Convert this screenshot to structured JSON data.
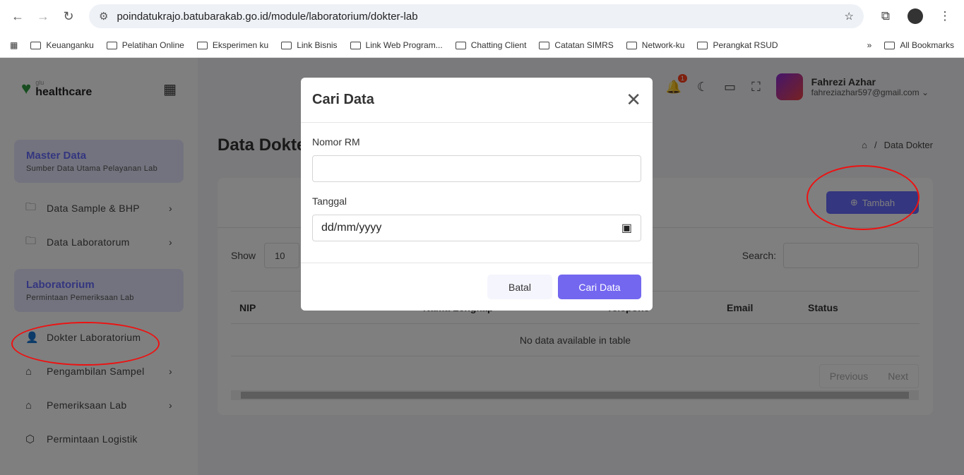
{
  "browser": {
    "url": "poindatukrajo.batubarakab.go.id/module/laboratorium/dokter-lab",
    "bookmarks": [
      "Keuanganku",
      "Pelatihan Online",
      "Eksperimen ku",
      "Link Bisnis",
      "Link Web Program...",
      "Chatting Client",
      "Catatan SIMRS",
      "Network-ku",
      "Perangkat RSUD"
    ],
    "all_bookmarks": "All Bookmarks"
  },
  "logo": {
    "small": "glu",
    "name": "healthcare"
  },
  "sidebar": {
    "master": {
      "title": "Master Data",
      "subtitle": "Sumber Data Utama Pelayanan Lab"
    },
    "master_items": [
      {
        "label": "Data Sample & BHP"
      },
      {
        "label": "Data Laboratorum"
      }
    ],
    "lab": {
      "title": "Laboratorium",
      "subtitle": "Permintaan Pemeriksaan Lab"
    },
    "lab_items": [
      {
        "label": "Dokter Laboratorium"
      },
      {
        "label": "Pengambilan Sampel"
      },
      {
        "label": "Pemeriksaan Lab"
      },
      {
        "label": "Permintaan Logistik"
      }
    ]
  },
  "header": {
    "notif_count": "1",
    "user_name": "Fahrezi Azhar",
    "user_email": "fahreziazhar597@gmail.com"
  },
  "page": {
    "title": "Data Dokter",
    "breadcrumb_sep": "/",
    "breadcrumb_current": "Data Dokter",
    "add_label": "Tambah",
    "show_label": "Show",
    "show_value": "10",
    "search_label": "Search:",
    "columns": [
      "NIP",
      "Nama Lengkap",
      "Telepone",
      "Email",
      "Status"
    ],
    "empty": "No data available in table",
    "prev": "Previous",
    "next": "Next"
  },
  "modal": {
    "title": "Cari Data",
    "field1_label": "Nomor RM",
    "field1_value": "",
    "field2_label": "Tanggal",
    "field2_placeholder": "dd/mm/yyyy",
    "cancel": "Batal",
    "submit": "Cari Data"
  }
}
